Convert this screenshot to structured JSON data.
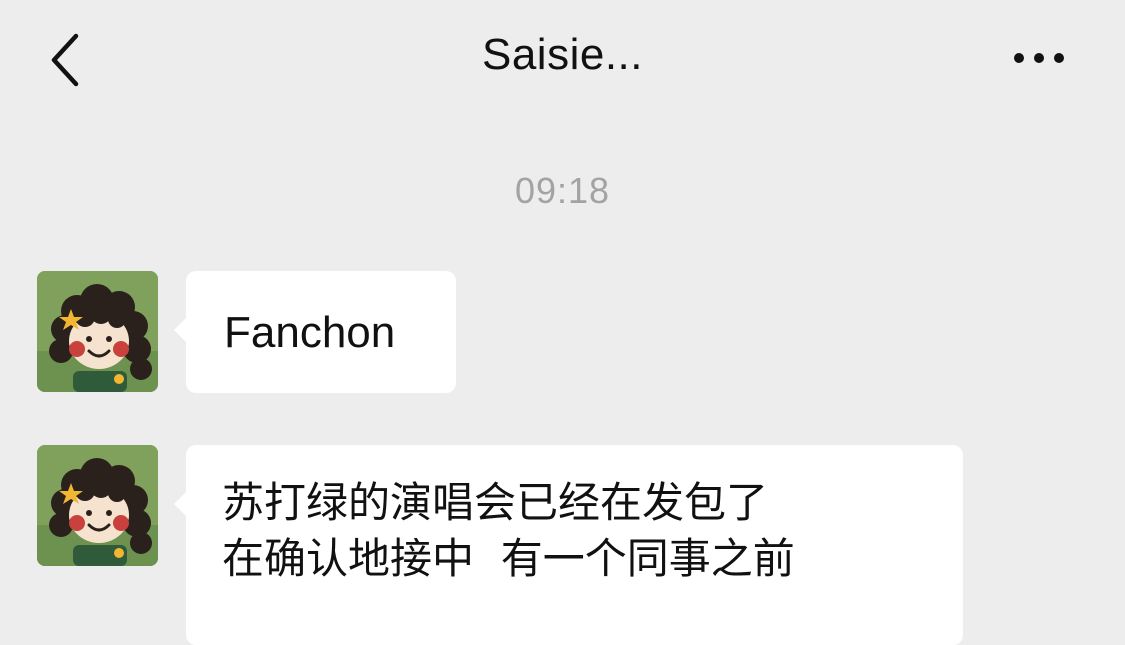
{
  "header": {
    "back_icon": "chevron-left-icon",
    "title": "Saisie...",
    "more_icon": "more-dots-icon"
  },
  "chat": {
    "timestamp": "09:18",
    "messages": [
      {
        "sender": "other",
        "avatar_icon": "cartoon-girl-avatar",
        "text": "Fanchon"
      },
      {
        "sender": "other",
        "avatar_icon": "cartoon-girl-avatar",
        "text": "苏打绿的演唱会已经在发包了\n在确认地接中  有一个同事之前"
      }
    ]
  },
  "colors": {
    "background": "#ededed",
    "bubble": "#ffffff",
    "timestamp": "#a3a3a3",
    "avatar_bg": "#7fa15c"
  }
}
